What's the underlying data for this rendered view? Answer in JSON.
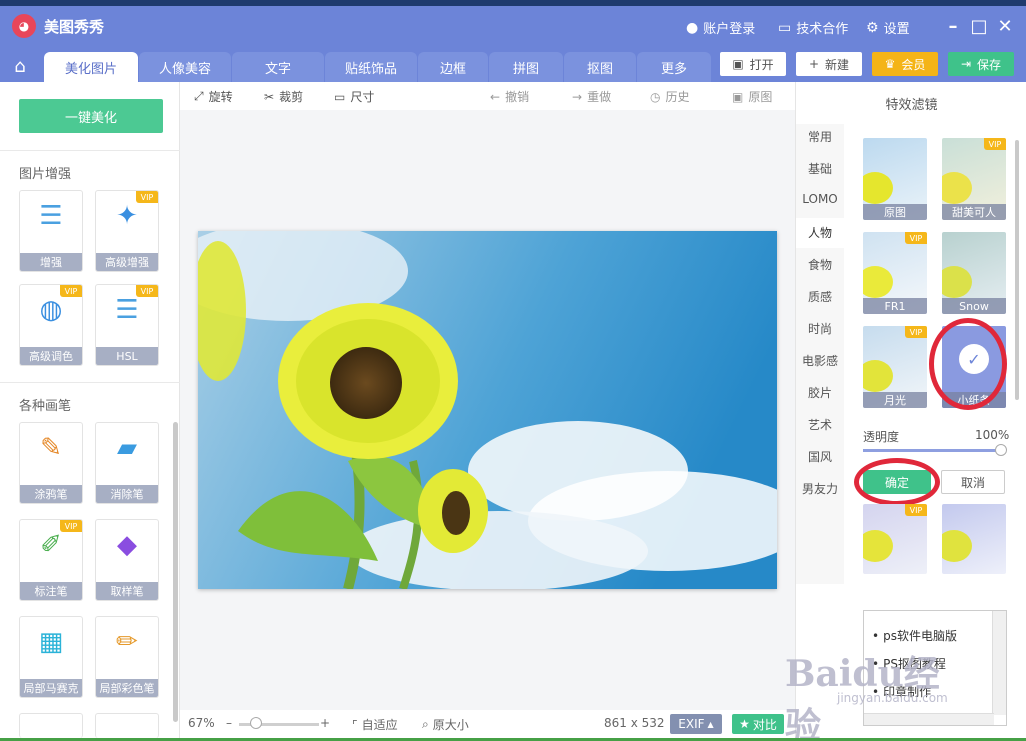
{
  "app": {
    "title": "美图秀秀"
  },
  "titlebar": {
    "login": "账户登录",
    "cooperation": "技术合作",
    "settings": "设置"
  },
  "tabs": [
    "美化图片",
    "人像美容",
    "文字",
    "贴纸饰品",
    "边框",
    "拼图",
    "抠图",
    "更多"
  ],
  "actions": {
    "open": "打开",
    "new": "新建",
    "member": "会员",
    "save": "保存"
  },
  "left": {
    "onekey": "一键美化",
    "section1": "图片增强",
    "section2": "各种画笔",
    "vip_badge": "VIP",
    "tools": [
      {
        "label": "增强",
        "vip": false
      },
      {
        "label": "高级增强",
        "vip": true
      },
      {
        "label": "高级调色",
        "vip": true
      },
      {
        "label": "HSL",
        "vip": true
      },
      {
        "label": "涂鸦笔",
        "vip": false
      },
      {
        "label": "消除笔",
        "vip": false
      },
      {
        "label": "标注笔",
        "vip": true
      },
      {
        "label": "取样笔",
        "vip": false
      },
      {
        "label": "局部马赛克",
        "vip": false
      },
      {
        "label": "局部彩色笔",
        "vip": false
      }
    ]
  },
  "editbar": {
    "rotate": "旋转",
    "crop": "裁剪",
    "size": "尺寸",
    "undo": "撤销",
    "redo": "重做",
    "history": "历史",
    "original": "原图"
  },
  "bottombar": {
    "zoom": "67%",
    "fit": "自适应",
    "actual": "原大小",
    "dimensions": "861 x 532",
    "exif": "EXIF",
    "compare": "对比"
  },
  "right": {
    "title": "特效滤镜",
    "categories": [
      "常用",
      "基础",
      "LOMO",
      "人物",
      "食物",
      "质感",
      "时尚",
      "电影感",
      "胶片",
      "艺术",
      "国风",
      "男友力"
    ],
    "active_category": "人物",
    "filters": [
      {
        "label": "原图",
        "vip": false
      },
      {
        "label": "甜美可人",
        "vip": true
      },
      {
        "label": "FR1",
        "vip": true
      },
      {
        "label": "Snow",
        "vip": false
      },
      {
        "label": "月光",
        "vip": true
      },
      {
        "label": "小纸条",
        "vip": false
      }
    ],
    "opacity_label": "透明度",
    "opacity_value": "100%",
    "ok": "确定",
    "cancel": "取消",
    "popup_items": [
      "ps软件电脑版",
      "PS抠图教程",
      "印章制作"
    ]
  },
  "watermark": {
    "main": "Baidu经验",
    "sub": "jingyan.baidu.com"
  },
  "colors": {
    "header": "#6c84d8",
    "accent_green": "#3fc28a",
    "vip": "#f5b71a",
    "highlight_red": "#e0283a"
  }
}
